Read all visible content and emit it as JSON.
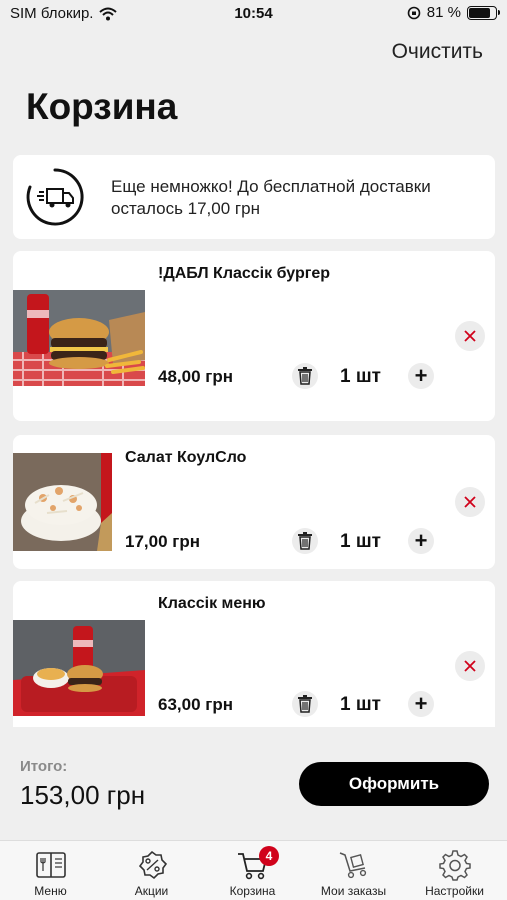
{
  "status_bar": {
    "carrier": "SIM блокир.",
    "time": "10:54",
    "battery": "81 %",
    "battery_level": 0.81
  },
  "header": {
    "clear_label": "Очистить",
    "title": "Корзина"
  },
  "delivery_banner": {
    "text": "Еще немножко! До бесплатной доставки осталось 17,00 грн",
    "icon": "delivery-truck-icon"
  },
  "cart_items": [
    {
      "name": "!ДАБЛ Классік бургер",
      "price": "48,00 грн",
      "quantity": "1 шт"
    },
    {
      "name": "Салат КоулСло",
      "price": "17,00 грн",
      "quantity": "1 шт"
    },
    {
      "name": "Классік меню",
      "price": "63,00 грн",
      "quantity": "1 шт"
    }
  ],
  "summary": {
    "total_label": "Итого:",
    "total_value": "153,00 грн",
    "checkout_label": "Оформить"
  },
  "tab_bar": {
    "tabs": [
      {
        "label": "Меню",
        "icon": "menu-book-icon"
      },
      {
        "label": "Акции",
        "icon": "discount-icon"
      },
      {
        "label": "Корзина",
        "icon": "cart-icon",
        "badge": "4"
      },
      {
        "label": "Мои заказы",
        "icon": "orders-cart-icon"
      },
      {
        "label": "Настройки",
        "icon": "gear-icon"
      }
    ]
  },
  "colors": {
    "accent": "#d0021b",
    "background": "#efefef",
    "button": "#000000"
  }
}
